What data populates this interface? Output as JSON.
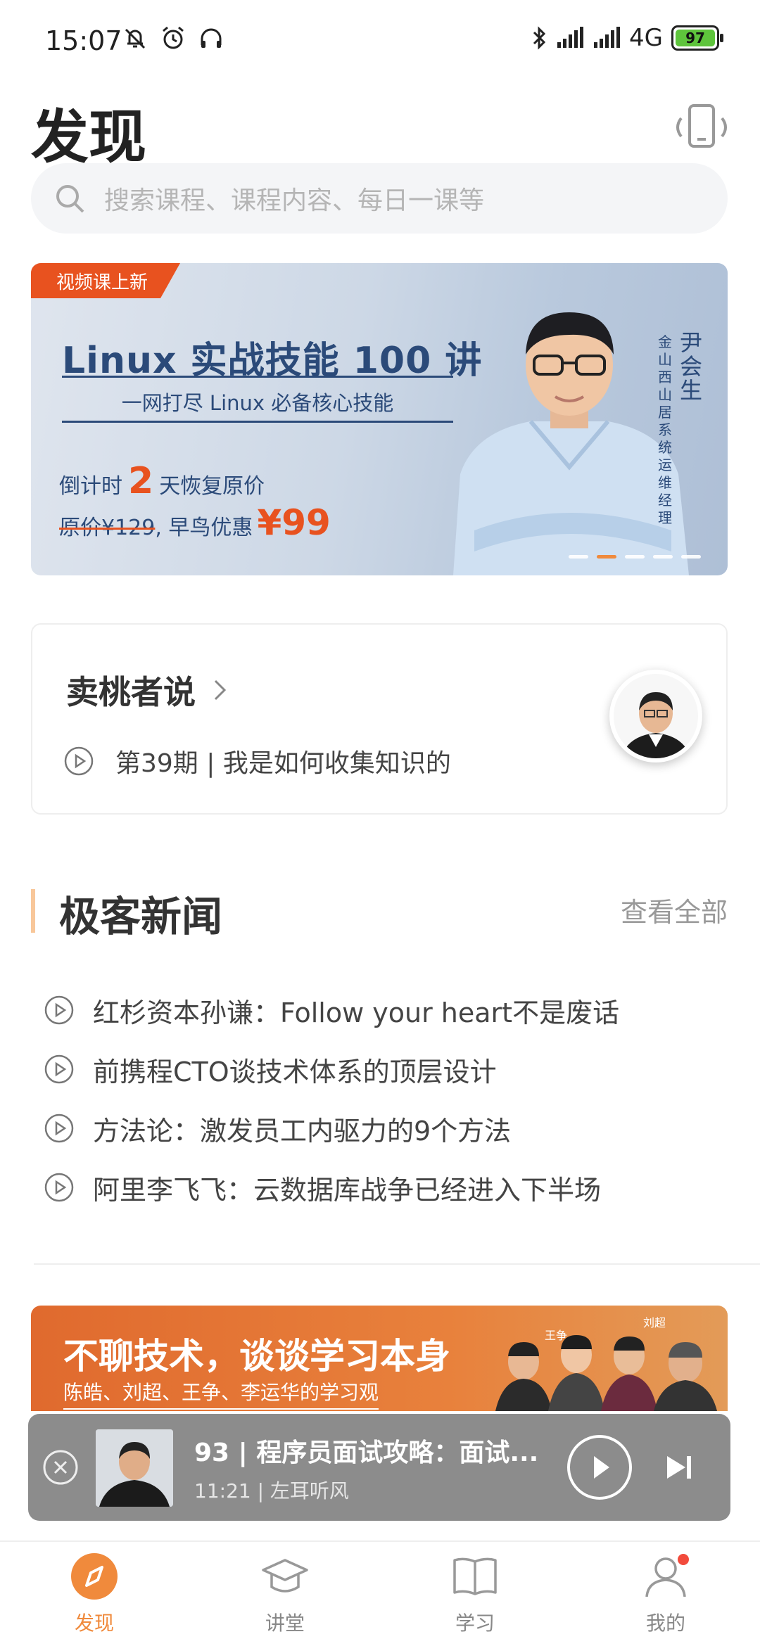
{
  "status_bar": {
    "time": "15:07",
    "network": "4G",
    "battery": "97"
  },
  "header": {
    "title": "发现",
    "search_placeholder": "搜索课程、课程内容、每日一课等"
  },
  "banner": {
    "tag": "视频课上新",
    "title": "Linux 实战技能 100 讲",
    "subtitle": "一网打尽 Linux 必备核心技能",
    "countdown_prefix": "倒计时",
    "countdown_days": "2",
    "countdown_suffix": "天恢复原价",
    "original_price": "原价¥129",
    "early_bird": ", 早鸟优惠",
    "sale_price": "¥99",
    "lecturer_name": "尹会生",
    "lecturer_role": "金山西山居系统运维经理",
    "slides": 5,
    "active_slide": 2
  },
  "featured": {
    "title": "卖桃者说",
    "episode": "第39期 | 我是如何收集知识的"
  },
  "news": {
    "title": "极客新闻",
    "view_all": "查看全部",
    "items": [
      "红杉资本孙谦：Follow your heart不是废话",
      "前携程CTO谈技术体系的顶层设计",
      "方法论：激发员工内驱力的9个方法",
      "阿里李飞飞：云数据库战争已经进入下半场"
    ]
  },
  "promo": {
    "title": "不聊技术，谈谈学习本身",
    "subtitle": "陈皓、刘超、王争、李运华的学习观",
    "name_1": "王争",
    "name_2": "刘超"
  },
  "mini_player": {
    "title": "93 | 程序员面试攻略：面试...",
    "meta": "11:21 | 左耳听风"
  },
  "tabs": [
    {
      "label": "发现",
      "active": true
    },
    {
      "label": "讲堂",
      "active": false
    },
    {
      "label": "学习",
      "active": false
    },
    {
      "label": "我的",
      "active": false
    }
  ],
  "colors": {
    "accent": "#f08a3c",
    "banner_red": "#e8521f",
    "banner_blue": "#2b4a79",
    "badge": "#f24b3c"
  }
}
